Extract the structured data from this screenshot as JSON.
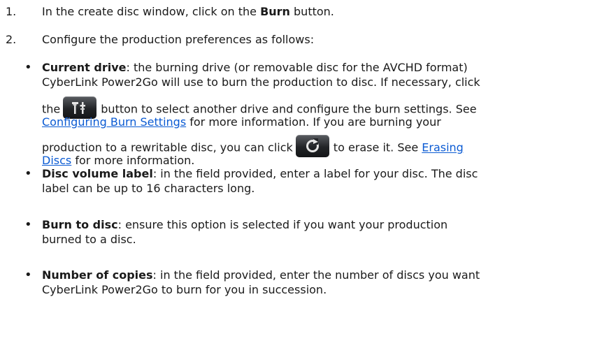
{
  "steps": [
    {
      "number": "1.",
      "text_before": "In the create disc window, click on the ",
      "bold": "Burn",
      "text_after": " button."
    },
    {
      "number": "2.",
      "text": "Configure the production preferences as follows:"
    }
  ],
  "bullets": {
    "current_drive": {
      "term": "Current drive",
      "l1": ": the burning drive (or removable disc for the AVCHD format)",
      "l2": "CyberLink Power2Go will use to burn the production to disc. If necessary, click",
      "l3_before": "the",
      "l3_after": "button to select another drive and configure the burn settings. See",
      "l4_link": "Configuring Burn Settings",
      "l4_after": " for more information. If you are burning your",
      "l5_before": "production to a rewritable disc, you can click",
      "l5_after": "to erase it. See ",
      "l5_link": "Erasing",
      "l6_link": "Discs",
      "l6_after": " for more information.",
      "settings_icon": "burn-settings-icon",
      "erase_icon": "erase-disc-icon"
    },
    "disc_volume_label": {
      "term": "Disc volume label",
      "l1": ": in the field provided, enter a label for your disc. The disc",
      "l2": "label can be up to 16 characters long."
    },
    "burn_to_disc": {
      "term": "Burn to disc",
      "l1": ": ensure this option is selected if you want your production",
      "l2": "burned to a disc."
    },
    "number_of_copies": {
      "term": "Number of copies",
      "l1": ": in the field provided, enter the number of discs you want",
      "l2": "CyberLink Power2Go to burn for you in succession."
    }
  },
  "colors": {
    "text": "#1a1a1a",
    "link": "#0b5bd3",
    "icon_button": "#222427"
  }
}
